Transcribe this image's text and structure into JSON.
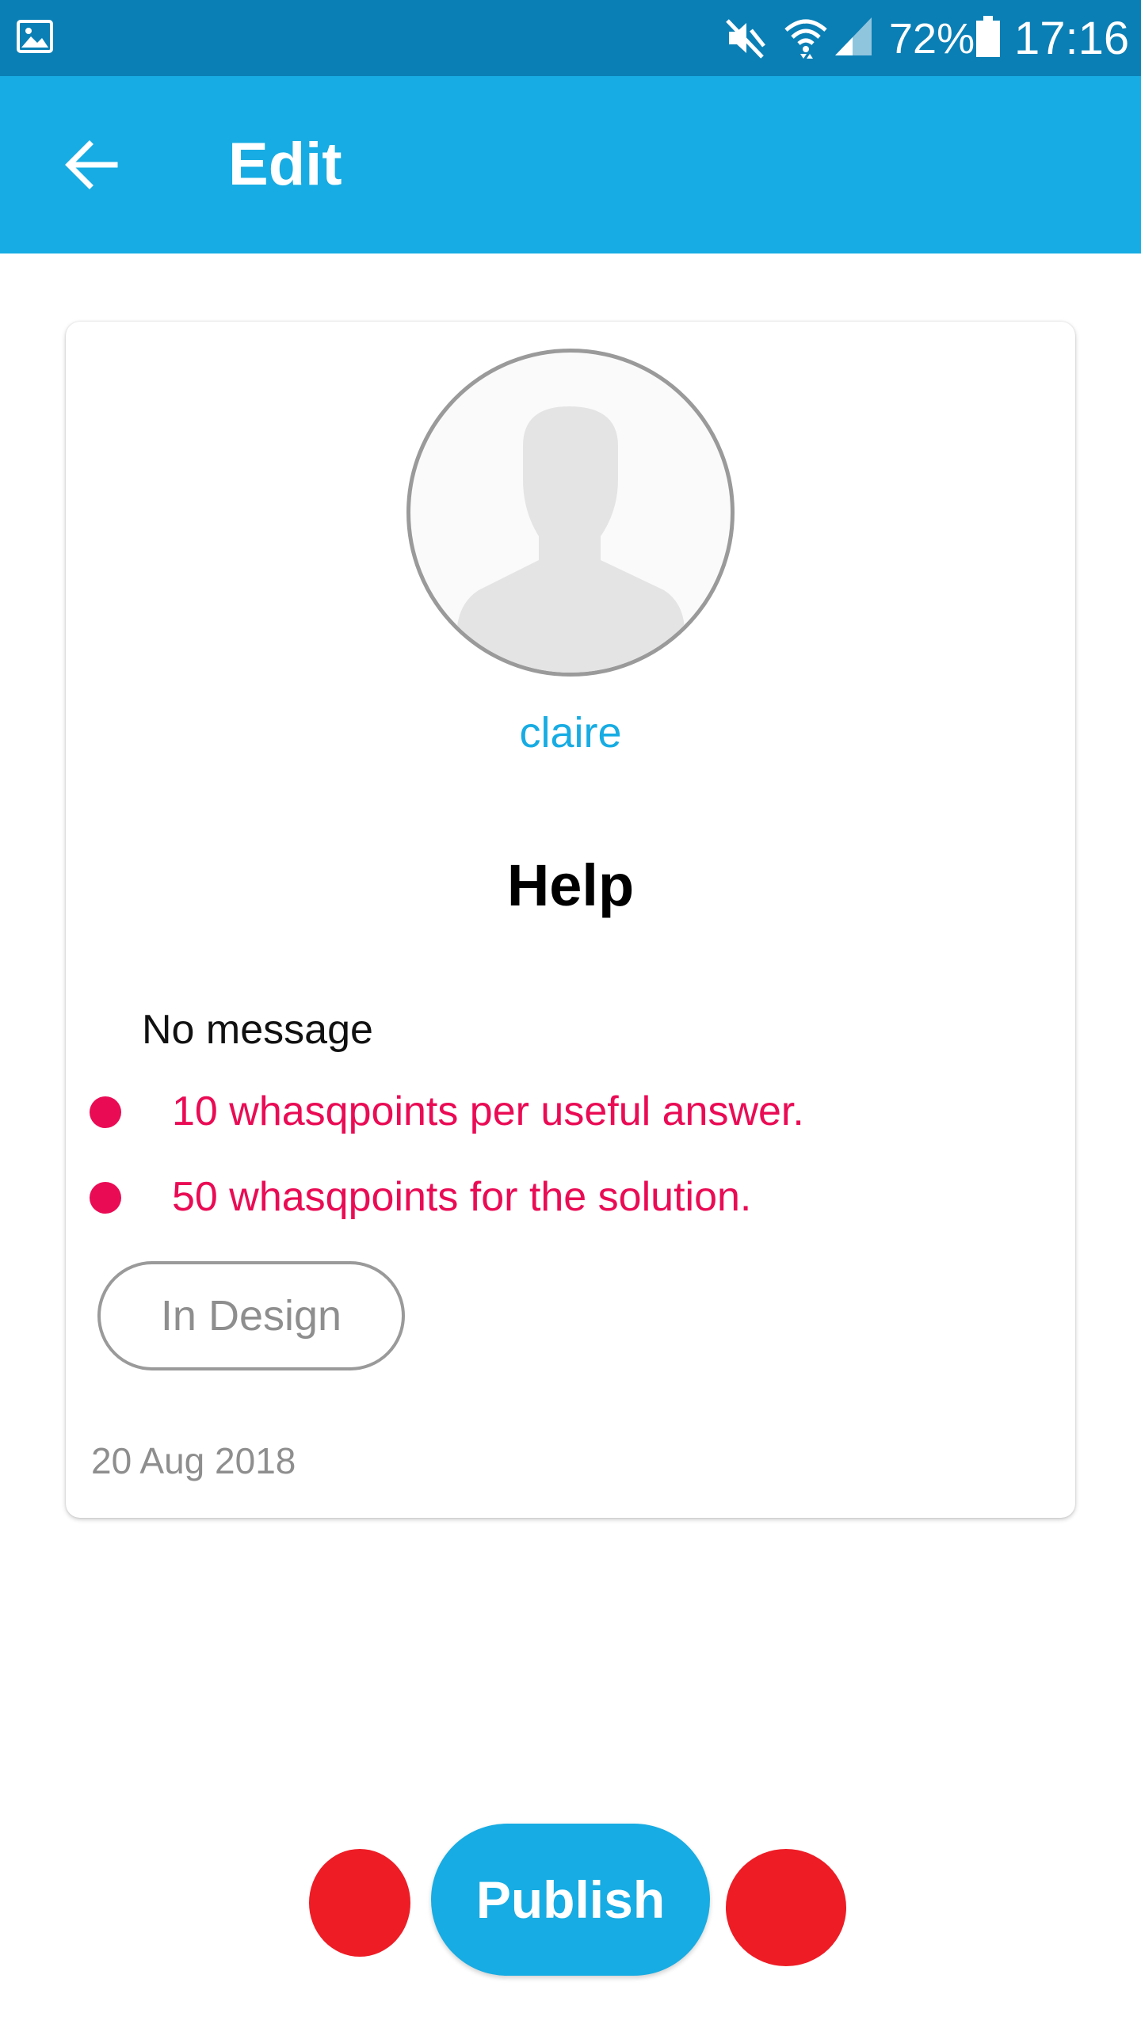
{
  "status_bar": {
    "battery": "72%",
    "time": "17:16",
    "icons": [
      "gallery-icon",
      "mute-icon",
      "wifi-icon",
      "signal-icon",
      "battery-icon"
    ]
  },
  "app_bar": {
    "title": "Edit",
    "back_icon": "arrow-left-icon"
  },
  "card": {
    "username": "claire",
    "title": "Help",
    "message": "No message",
    "rewards": [
      "10 whasqpoints per useful answer.",
      "50 whasqpoints for the solution."
    ],
    "status": "In Design",
    "date": "20 Aug 2018"
  },
  "actions": {
    "publish_label": "Publish"
  },
  "colors": {
    "status_bar": "#0a7fb5",
    "app_bar": "#17ace3",
    "accent": "#17ace3",
    "reward": "#ea0b55",
    "action_dot": "#ee1c25",
    "muted": "#8e8e8e"
  }
}
